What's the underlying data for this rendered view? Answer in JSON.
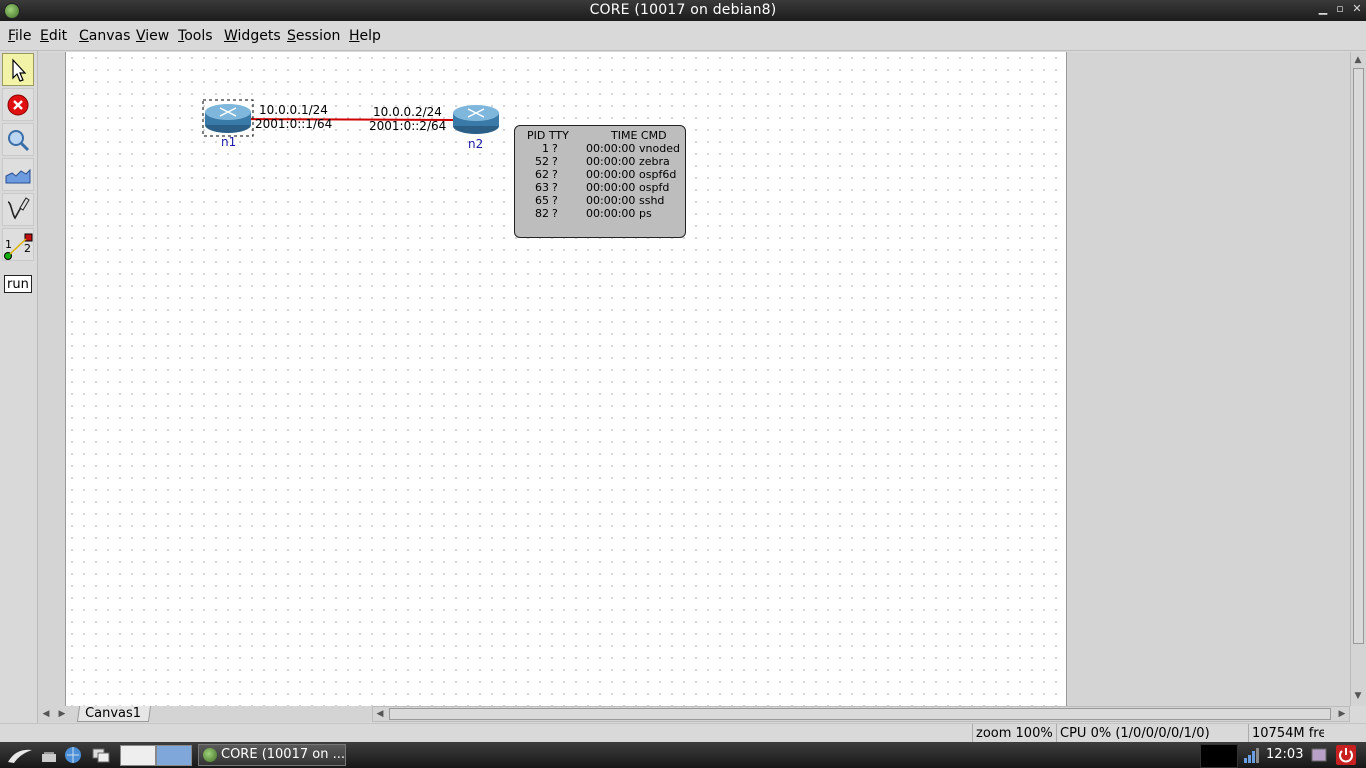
{
  "window": {
    "title": "CORE (10017 on debian8)"
  },
  "menubar": {
    "items": [
      {
        "label": "File",
        "ul": "F",
        "rest": "ile"
      },
      {
        "label": "Edit",
        "ul": "E",
        "rest": "dit"
      },
      {
        "label": "Canvas",
        "ul": "C",
        "rest": "anvas"
      },
      {
        "label": "View",
        "ul": "V",
        "rest": "iew"
      },
      {
        "label": "Tools",
        "ul": "T",
        "rest": "ools"
      },
      {
        "label": "Widgets",
        "ul": "W",
        "rest": "idgets"
      },
      {
        "label": "Session",
        "ul": "S",
        "rest": "ession"
      },
      {
        "label": "Help",
        "ul": "H",
        "rest": "elp"
      }
    ]
  },
  "toolbar": {
    "tools": [
      "select-tool",
      "stop-tool",
      "observer-tool",
      "plot-tool",
      "marker-tool",
      "two-node-tool",
      "run-tool"
    ],
    "link_tool_left": "1",
    "link_tool_right": "2",
    "run_label": "run"
  },
  "topology": {
    "nodes": [
      {
        "name": "n1"
      },
      {
        "name": "n2"
      }
    ],
    "link": {
      "n1_ipv4": "10.0.0.1/24",
      "n1_ipv6": "2001:0::1/64",
      "n2_ipv4": "10.0.0.2/24",
      "n2_ipv6": "2001:0::2/64",
      "color": "#d00000"
    }
  },
  "process_popup": {
    "header_pid_tty": "PID TTY",
    "header_time_cmd": "TIME CMD",
    "rows": [
      {
        "pid": "1",
        "tty": "?",
        "time": "00:00:00",
        "cmd": "vnoded"
      },
      {
        "pid": "52",
        "tty": "?",
        "time": "00:00:00",
        "cmd": "zebra"
      },
      {
        "pid": "62",
        "tty": "?",
        "time": "00:00:00",
        "cmd": "ospf6d"
      },
      {
        "pid": "63",
        "tty": "?",
        "time": "00:00:00",
        "cmd": "ospfd"
      },
      {
        "pid": "65",
        "tty": "?",
        "time": "00:00:00",
        "cmd": "sshd"
      },
      {
        "pid": "82",
        "tty": "?",
        "time": "00:00:00",
        "cmd": "ps"
      }
    ]
  },
  "canvas_tabs": [
    "Canvas1"
  ],
  "statusbar": {
    "zoom": "zoom 100%",
    "cpu": "CPU 0% (1/0/0/0/0/1/0)",
    "mem": "10754M fre"
  },
  "taskbar": {
    "task_label": "CORE (10017 on ...",
    "clock": "12:03"
  },
  "colors": {
    "link": "#d00000",
    "node_label": "#1c1ca8",
    "active_tool": "#f3f3a8"
  }
}
